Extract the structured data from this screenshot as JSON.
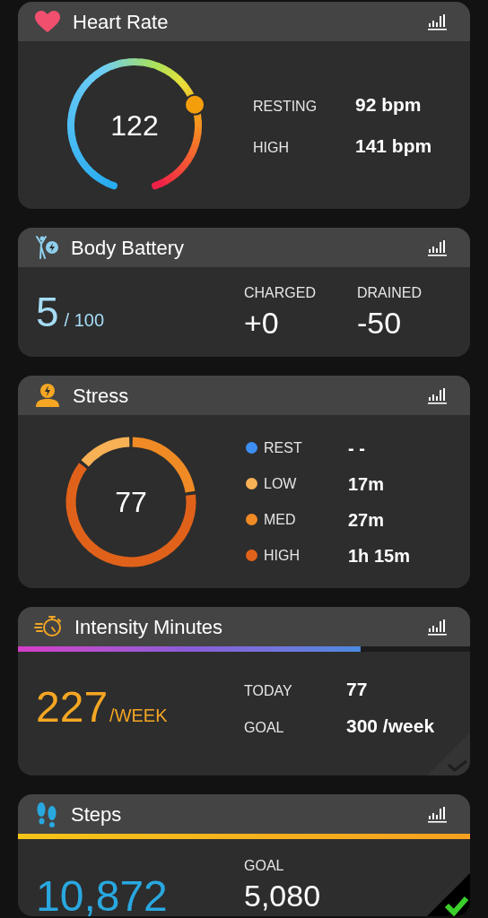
{
  "cards": [
    {
      "kind": "heart_rate",
      "title": "Heart Rate",
      "value": "122",
      "stats": [
        {
          "label": "RESTING",
          "value": "92 bpm"
        },
        {
          "label": "HIGH",
          "value": "141 bpm"
        }
      ]
    },
    {
      "kind": "body_battery",
      "title": "Body Battery",
      "value": "5",
      "unit": "/ 100",
      "stats": [
        {
          "label": "CHARGED",
          "value": "+0"
        },
        {
          "label": "DRAINED",
          "value": "-50"
        }
      ]
    },
    {
      "kind": "stress",
      "title": "Stress",
      "value": "77",
      "legend": [
        {
          "label": "REST",
          "value": "- -",
          "color": "#3d8ef0"
        },
        {
          "label": "LOW",
          "value": "17m",
          "color": "#f8b155"
        },
        {
          "label": "MED",
          "value": "27m",
          "color": "#f08a24"
        },
        {
          "label": "HIGH",
          "value": "1h 15m",
          "color": "#e0621a"
        }
      ]
    },
    {
      "kind": "intensity",
      "title": "Intensity Minutes",
      "level": 0.757,
      "value": "227",
      "unit": "/WEEK",
      "goal_met": false,
      "stats": [
        {
          "label": "TODAY",
          "value": "77"
        },
        {
          "label": "GOAL",
          "value": "300 /week"
        }
      ]
    },
    {
      "kind": "steps",
      "title": "Steps",
      "level": 1,
      "value": "10,872",
      "goal_met": true,
      "stats": [
        {
          "label": "GOAL",
          "value": "5,080"
        }
      ]
    }
  ]
}
